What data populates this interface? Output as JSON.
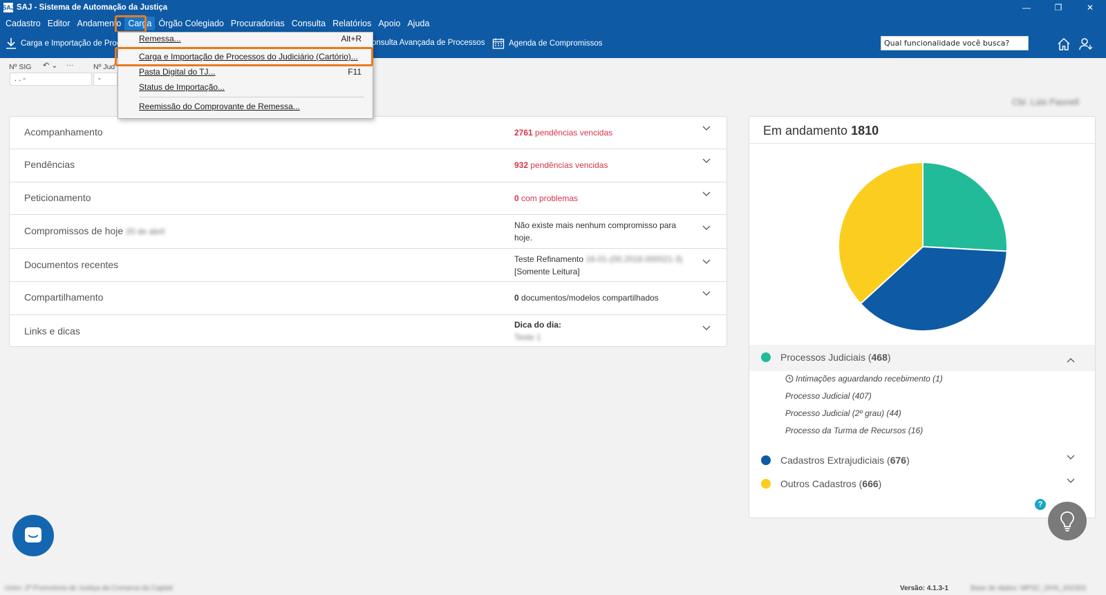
{
  "window": {
    "title": "SAJ - Sistema de Automação da Justiça",
    "app_icon_text": "SAJ"
  },
  "menu": {
    "items": [
      "Cadastro",
      "Editor",
      "Andamento",
      "Carga",
      "Órgão Colegiado",
      "Procuradorias",
      "Consulta",
      "Relatórios",
      "Apoio",
      "Ajuda"
    ],
    "active": "Carga"
  },
  "toolbar": {
    "carga_label": "Carga e Importação de Proc",
    "consulta_label": "onsulta Avançada de Processos",
    "agenda_label": "Agenda de Compromissos",
    "search_placeholder": "Qual funcionalidade você busca?"
  },
  "sig": {
    "label_sig": "Nº SIG",
    "label_jud": "Nº Jud",
    "sig_value": ". .   -",
    "jud_value": "-",
    "more": "···"
  },
  "dropdown": {
    "items": [
      {
        "label": "Remessa...",
        "shortcut": "Alt+R"
      },
      {
        "label": "Carga e Importação de Processos do Judiciário (Cartório)...",
        "shortcut": ""
      },
      {
        "label": "Pasta Digital do TJ...",
        "shortcut": "F11"
      },
      {
        "label": "Status de Importação...",
        "shortcut": ""
      },
      {
        "label": "Reemissão do Comprovante de Remessa...",
        "shortcut": ""
      }
    ]
  },
  "user_name": "Cbl. Lúis Pasnell",
  "accordion": [
    {
      "title": "Acompanhamento",
      "num": "2761",
      "text": " pendências vencidas",
      "red": true
    },
    {
      "title": "Pendências",
      "num": "932",
      "text": " pendências vencidas",
      "red": true
    },
    {
      "title": "Peticionamento",
      "num": "0",
      "text": " com problemas",
      "red": true
    },
    {
      "title": "Compromissos de hoje",
      "title_extra": "20 de abril",
      "line1": "Não existe mais nenhum compromisso para",
      "line2": "hoje."
    },
    {
      "title": "Documentos recentes",
      "line1": "Teste Refinamento",
      "line1_extra": "16-01-(00.2018.000021-3)",
      "line2": "[Somente Leitura]"
    },
    {
      "title": "Compartilhamento",
      "num": "0",
      "text": " documentos/modelos compartilhados",
      "red": false
    },
    {
      "title": "Links e dicas",
      "line1": "Dica do dia:",
      "line2": "Teste 1"
    }
  ],
  "right_panel": {
    "title": "Em andamento",
    "total": "1810",
    "legend": [
      {
        "name": "Processos Judiciais",
        "count": "468",
        "color": "#22bb99"
      },
      {
        "name": "Cadastros Extrajudiciais",
        "count": "676",
        "color": "#0e5aa5"
      },
      {
        "name": "Outros Cadastros",
        "count": "666",
        "color": "#fbcd1e"
      }
    ],
    "sub_items": [
      "Intimações aguardando recebimento (1)",
      "Processo Judicial (407)",
      "Processo Judicial (2º grau) (44)",
      "Processo da Turma de Recursos (16)"
    ]
  },
  "chart_data": {
    "type": "pie",
    "title": "",
    "categories": [
      "Processos Judiciais",
      "Cadastros Extrajudiciais",
      "Outros Cadastros"
    ],
    "values": [
      468,
      676,
      666
    ],
    "colors": [
      "#22bb99",
      "#0e5aa5",
      "#fbcd1e"
    ]
  },
  "help_label": "?",
  "statusbar": {
    "left": "Unim: 2ª Promotoria de Justiça da Comarca da Capital",
    "version": "Versão: 4.1.3-1",
    "right": "Base de dados: MPSC_DHS_202303"
  }
}
